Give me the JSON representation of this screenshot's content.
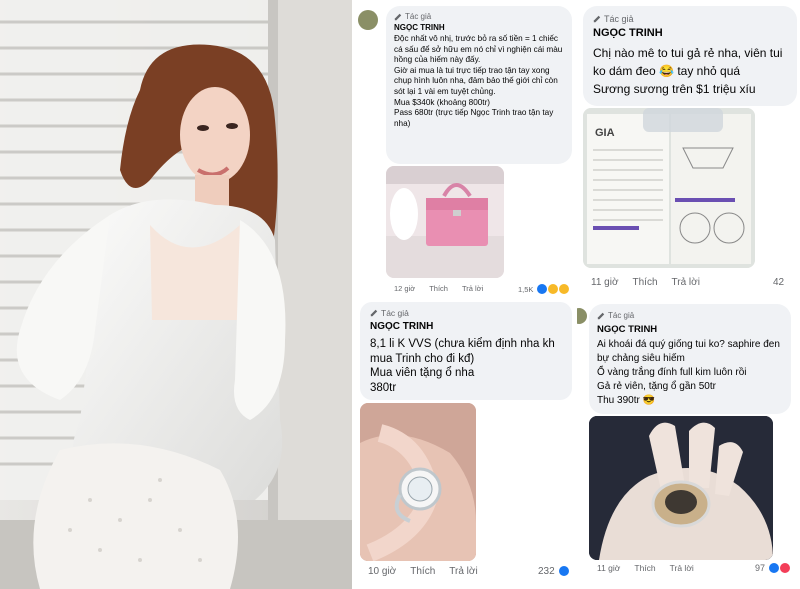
{
  "posts": [
    {
      "tag": "Tác giả",
      "author": "NGỌC TRINH",
      "body": "Độc nhất vô nhị, trước bỏ ra số tiền = 1 chiếc cá sấu để sở hữu em nó chỉ vì nghiện cái màu hồng của hiếm này đấy.\nGiờ ai mua là tui trực tiếp trao tận tay xong chụp hình luôn nha, đảm bảo thế giới chỉ còn sót lại 1 vài em tuyệt chủng.\nMua $340k (khoảng 800tr)\nPass 680tr (trực tiếp Ngọc Trinh trao tận tay nha)",
      "time": "12 giờ",
      "like": "Thích",
      "reply": "Trả lời",
      "reaction_count": "1,5K"
    },
    {
      "tag": "Tác giả",
      "author": "NGỌC TRINH",
      "body": "Chị nào mê to tui gả rẻ nha, viên tui ko dám đeo 😂 tay nhỏ quá\nSương sương trên $1 triệu xíu",
      "time": "11 giờ",
      "like": "Thích",
      "reply": "Trả lời",
      "reaction_count": "42",
      "image_text": "GIA"
    },
    {
      "tag": "Tác giả",
      "author": "NGỌC TRINH",
      "body": "8,1 li K VVS (chưa kiểm định nha kh mua Trinh cho đi kđ)\nMua viên tặng ổ nha\n380tr",
      "time": "10 giờ",
      "like": "Thích",
      "reply": "Trả lời",
      "reaction_count": "232"
    },
    {
      "tag": "Tác giả",
      "author": "NGỌC TRINH",
      "body": "Ai khoái đá quý giống tui ko? saphire đen bự chảng siêu hiếm\nỔ vàng trắng đính full kim luôn rồi\nGả rẻ viên, tặng ổ gần 50tr\nThu 390tr 😎",
      "time": "11 giờ",
      "like": "Thích",
      "reply": "Trả lời",
      "reaction_count": "97"
    }
  ],
  "colors": {
    "bubble": "#f0f2f5",
    "meta": "#65676b",
    "text": "#050505",
    "like_blue": "#1877f2",
    "haha_yellow": "#f7b928",
    "bag_pink": "#e98fb2"
  }
}
